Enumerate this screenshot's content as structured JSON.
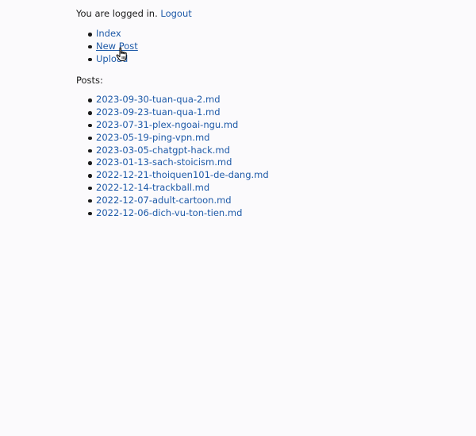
{
  "session": {
    "status_text": "You are logged in.",
    "logout_label": "Logout"
  },
  "nav": {
    "items": [
      {
        "label": "Index"
      },
      {
        "label": "New Post"
      },
      {
        "label": "Upload"
      }
    ]
  },
  "posts": {
    "heading": "Posts:",
    "items": [
      {
        "label": "2023-09-30-tuan-qua-2.md"
      },
      {
        "label": "2023-09-23-tuan-qua-1.md"
      },
      {
        "label": "2023-07-31-plex-ngoai-ngu.md"
      },
      {
        "label": "2023-05-19-ping-vpn.md"
      },
      {
        "label": "2023-03-05-chatgpt-hack.md"
      },
      {
        "label": "2023-01-13-sach-stoicism.md"
      },
      {
        "label": "2022-12-21-thoiquen101-de-dang.md"
      },
      {
        "label": "2022-12-14-trackball.md"
      },
      {
        "label": "2022-12-07-adult-cartoon.md"
      },
      {
        "label": "2022-12-06-dich-vu-ton-tien.md"
      }
    ]
  },
  "cursor": {
    "icon": "hand-pointer-icon"
  }
}
